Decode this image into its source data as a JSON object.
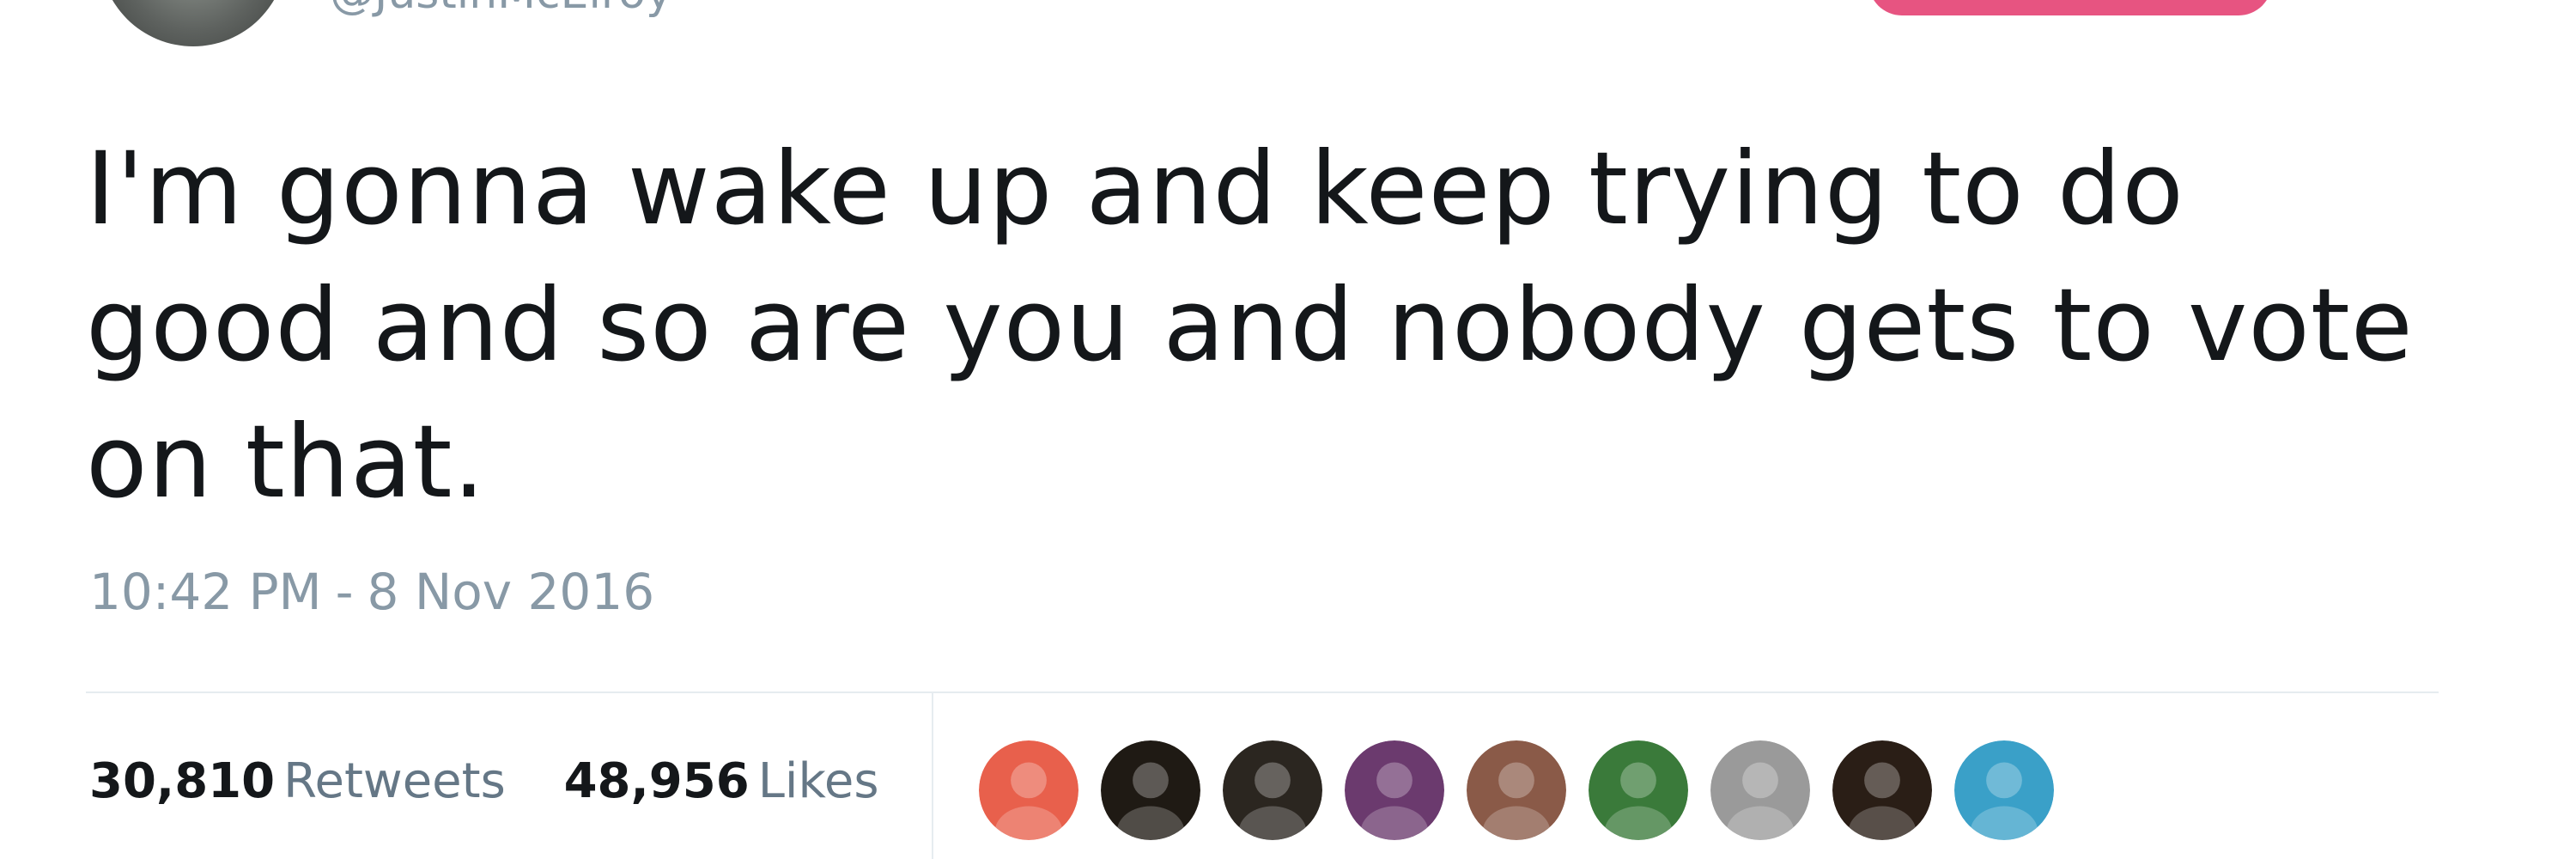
{
  "author": {
    "handle": "@JustinMcElroy"
  },
  "tweet": {
    "text": "I'm gonna wake up and keep trying to do\ngood and so are you and nobody gets to vote\non that.",
    "time": "10:42 PM",
    "separator": "-",
    "date": "8 Nov 2016"
  },
  "stats": {
    "retweets_count": "30,810",
    "retweets_label": "Retweets",
    "likes_count": "48,956",
    "likes_label": "Likes"
  },
  "likers": [
    {
      "icon": "user-avatar-icon",
      "color": "#e8604c"
    },
    {
      "icon": "user-avatar-icon",
      "color": "#1f1a14"
    },
    {
      "icon": "user-avatar-icon",
      "color": "#2b2620"
    },
    {
      "icon": "user-avatar-icon",
      "color": "#6b3a6e"
    },
    {
      "icon": "user-avatar-icon",
      "color": "#8a5a48"
    },
    {
      "icon": "user-avatar-icon",
      "color": "#3a7a3a"
    },
    {
      "icon": "user-avatar-icon",
      "color": "#9a9a9a"
    },
    {
      "icon": "user-avatar-icon",
      "color": "#2a1e16"
    },
    {
      "icon": "user-avatar-icon",
      "color": "#3aa0c8"
    }
  ],
  "colors": {
    "text": "#14171a",
    "muted": "#8899a6",
    "follow_button": "#e0245e",
    "divider": "#e6ecf0"
  }
}
